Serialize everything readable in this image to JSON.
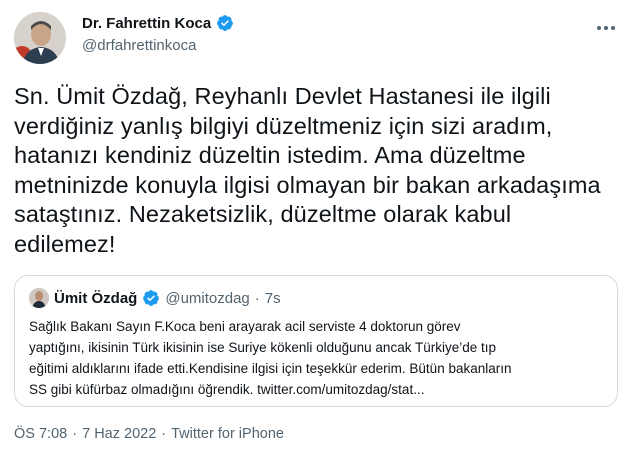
{
  "author": {
    "name": "Dr. Fahrettin Koca",
    "handle": "@drfahrettinkoca"
  },
  "tweet": {
    "lines": [
      "Sn. Ümit Özdağ, Reyhanlı Devlet Hastanesi ile ilgili",
      "verdiğiniz yanlış bilgiyi düzeltmeniz için sizi aradım,",
      "hatanızı kendiniz düzeltin istedim. Ama düzeltme",
      "metninizde konuyla ilgisi olmayan bir bakan arkadaşıma",
      "sataştınız. Nezaketsizlik, düzeltme olarak kabul",
      "edilemez!"
    ]
  },
  "quote": {
    "name": "Ümit Özdağ",
    "handle": "@umitozdag",
    "separator": "·",
    "time": "7s",
    "lines": [
      "Sağlık Bakanı  Sayın F.Koca beni arayarak acil serviste 4 doktorun görev",
      "yaptığını, ikisinin Türk ikisinin ise Suriye kökenli olduğunu ancak Türkiye’de tıp",
      "eğitimi aldıklarını ifade etti.Kendisine ilgisi için teşekkür ederim. Bütün bakanların",
      "SS gibi küfürbaz olmadığını öğrendik. twitter.com/umitozdag/stat..."
    ]
  },
  "footer": {
    "time": "ÖS 7:08",
    "separator1": "·",
    "date": "7 Haz 2022",
    "separator2": "·",
    "source": "Twitter for iPhone"
  },
  "colors": {
    "verified": "#1d9bf0",
    "text": "#0f1419",
    "secondary": "#536471",
    "border": "#cfd9de"
  },
  "icons": {
    "verified": "verified-badge-icon",
    "more": "more-dots-icon"
  }
}
